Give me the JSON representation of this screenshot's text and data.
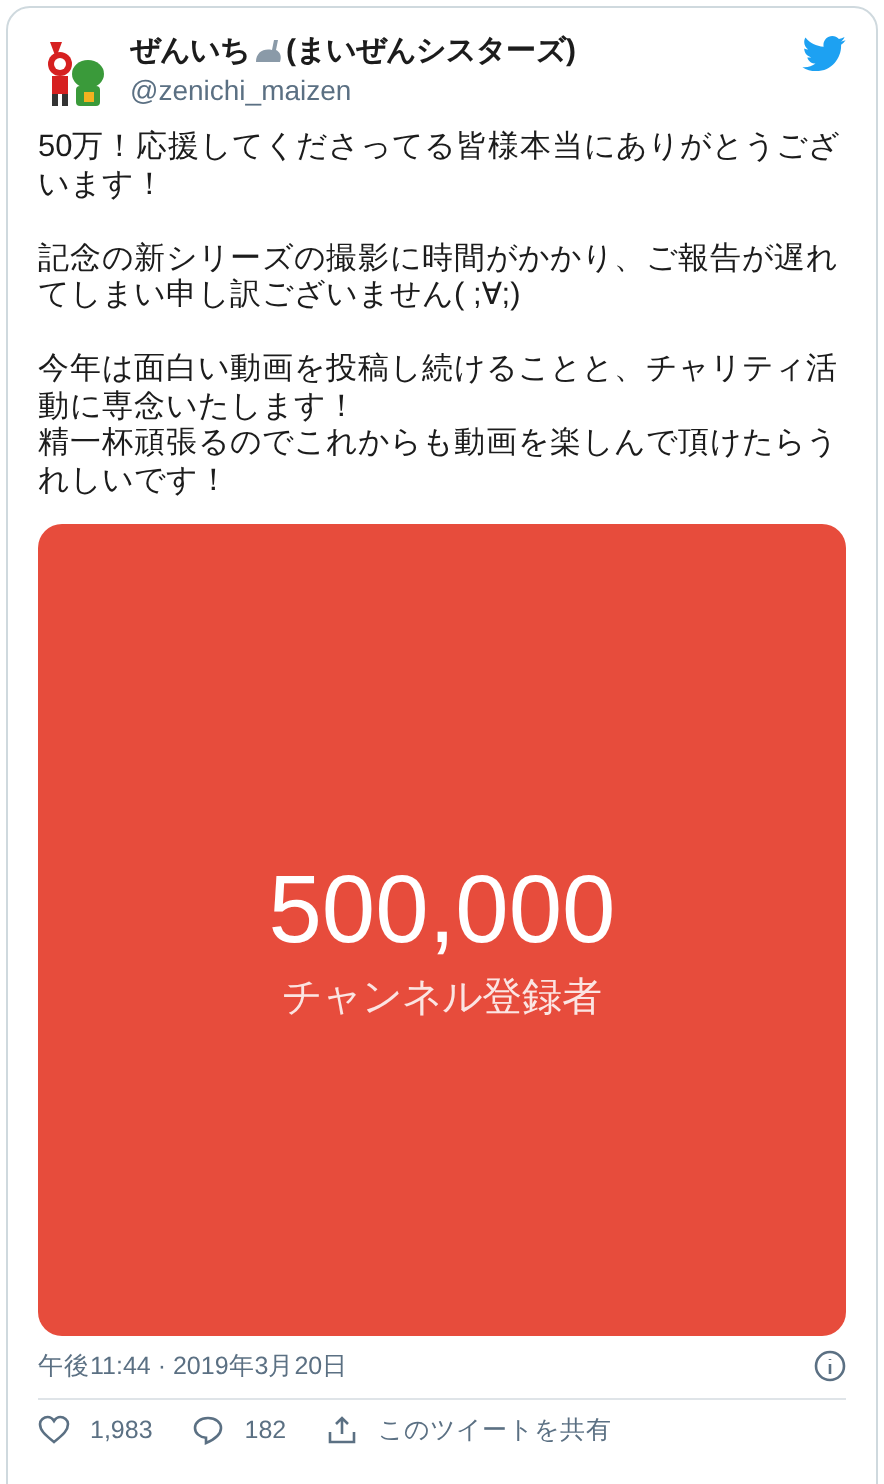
{
  "author": {
    "name_before": "ぜんいち",
    "name_after": "(まいぜんシスターズ)",
    "handle": "@zenichi_maizen"
  },
  "paragraphs": [
    [
      "50万！応援してくださってる皆様本当にありがとうございます！"
    ],
    [
      "記念の新シリーズの撮影に時間がかかり、ご報告が遅れてしまい申し訳ございません( ;∀;)"
    ],
    [
      "今年は面白い動画を投稿し続けることと、チャリティ活動に専念いたします！",
      "精一杯頑張るのでこれからも動画を楽しんで頂けたらうれしいです！"
    ]
  ],
  "media": {
    "number": "500,000",
    "caption": "チャンネル登録者",
    "color": "#e74c3c"
  },
  "timestamp": "午後11:44 · 2019年3月20日",
  "actions": [
    {
      "kind": "like",
      "label": "1,983"
    },
    {
      "kind": "reply",
      "label": "182"
    },
    {
      "kind": "share",
      "label": "このツイートを共有"
    }
  ]
}
